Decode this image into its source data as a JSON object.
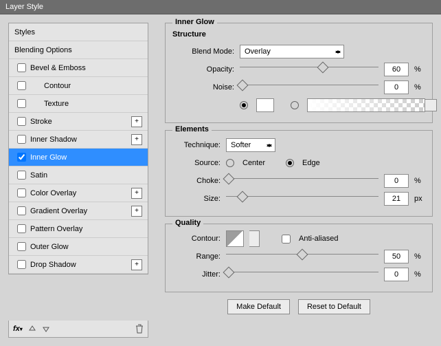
{
  "window": {
    "title": "Layer Style"
  },
  "sidebar": {
    "styles_header": "Styles",
    "blending_header": "Blending Options",
    "items": [
      {
        "label": "Bevel & Emboss",
        "indent": false,
        "plus": false
      },
      {
        "label": "Contour",
        "indent": true,
        "plus": false
      },
      {
        "label": "Texture",
        "indent": true,
        "plus": false
      },
      {
        "label": "Stroke",
        "indent": false,
        "plus": true
      },
      {
        "label": "Inner Shadow",
        "indent": false,
        "plus": true
      },
      {
        "label": "Inner Glow",
        "indent": false,
        "plus": false,
        "selected": true,
        "checked": true
      },
      {
        "label": "Satin",
        "indent": false,
        "plus": false
      },
      {
        "label": "Color Overlay",
        "indent": false,
        "plus": true
      },
      {
        "label": "Gradient Overlay",
        "indent": false,
        "plus": true
      },
      {
        "label": "Pattern Overlay",
        "indent": false,
        "plus": false
      },
      {
        "label": "Outer Glow",
        "indent": false,
        "plus": false
      },
      {
        "label": "Drop Shadow",
        "indent": false,
        "plus": true
      }
    ]
  },
  "panel": {
    "title": "Inner Glow",
    "structure": {
      "title": "Structure",
      "blend_mode_label": "Blend Mode:",
      "blend_mode_value": "Overlay",
      "opacity_label": "Opacity:",
      "opacity_value": "60",
      "opacity_unit": "%",
      "noise_label": "Noise:",
      "noise_value": "0",
      "noise_unit": "%"
    },
    "elements": {
      "title": "Elements",
      "technique_label": "Technique:",
      "technique_value": "Softer",
      "source_label": "Source:",
      "source_center": "Center",
      "source_edge": "Edge",
      "choke_label": "Choke:",
      "choke_value": "0",
      "choke_unit": "%",
      "size_label": "Size:",
      "size_value": "21",
      "size_unit": "px"
    },
    "quality": {
      "title": "Quality",
      "contour_label": "Contour:",
      "anti_aliased_label": "Anti-aliased",
      "range_label": "Range:",
      "range_value": "50",
      "range_unit": "%",
      "jitter_label": "Jitter:",
      "jitter_value": "0",
      "jitter_unit": "%"
    },
    "buttons": {
      "make_default": "Make Default",
      "reset": "Reset to Default"
    }
  },
  "positions": {
    "opacity": 60,
    "noise": 2,
    "choke": 2,
    "size": 11,
    "range": 50,
    "jitter": 2
  }
}
